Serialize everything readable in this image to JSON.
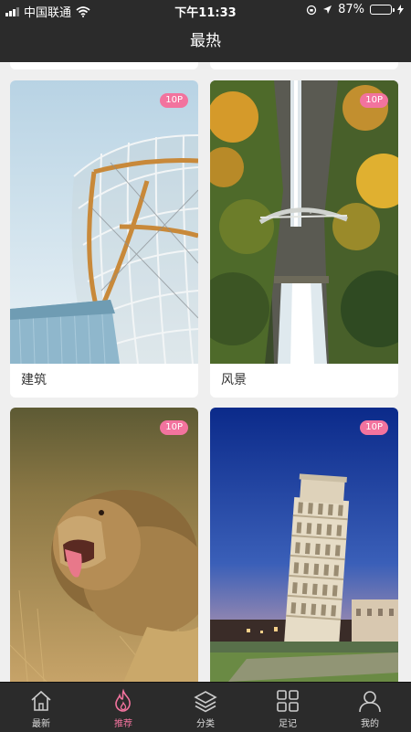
{
  "status": {
    "carrier": "中国联通",
    "time": "下午11:33",
    "battery_pct": "87%",
    "battery_level": 0.87,
    "battery_color": "#35d04a"
  },
  "header": {
    "title": "最热"
  },
  "cards": [
    {
      "badge": "10P",
      "caption": "建筑",
      "image": "architecture-glass-structure"
    },
    {
      "badge": "10P",
      "caption": "风景",
      "image": "waterfall-bridge-landscape"
    },
    {
      "badge": "10P",
      "caption": "",
      "image": "yawning-lion"
    },
    {
      "badge": "10P",
      "caption": "",
      "image": "leaning-tower-of-pisa"
    }
  ],
  "tabbar": {
    "active_color": "#f2739e",
    "items": [
      {
        "label": "最新",
        "icon": "home-icon"
      },
      {
        "label": "推荐",
        "icon": "flame-icon"
      },
      {
        "label": "分类",
        "icon": "layers-icon"
      },
      {
        "label": "足记",
        "icon": "grid-icon"
      },
      {
        "label": "我的",
        "icon": "user-icon"
      }
    ]
  }
}
